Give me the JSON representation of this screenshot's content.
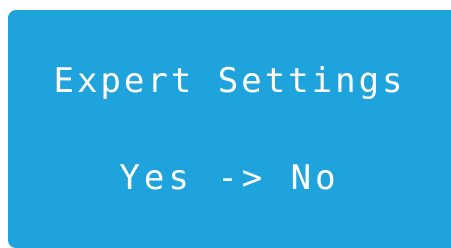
{
  "screen": {
    "background_color": "#1fa3dc",
    "text_color": "#ffffff",
    "title": "Expert Settings",
    "value": "Yes -> No"
  }
}
